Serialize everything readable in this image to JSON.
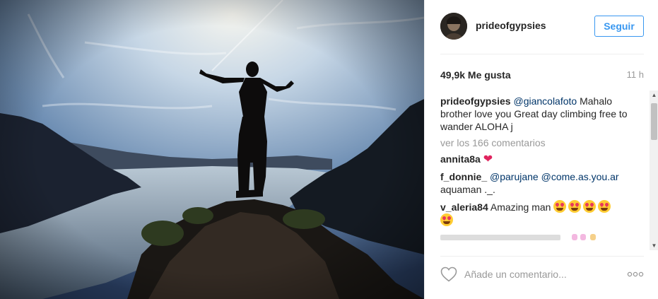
{
  "post": {
    "username": "prideofgypsies",
    "follow_label": "Seguir",
    "likes": "49,9k Me gusta",
    "time_ago": "11 h",
    "caption": {
      "user": "prideofgypsies",
      "mention": "@giancolafoto",
      "text": " Mahalo brother love you Great day climbing free to wander ALOHA j"
    },
    "view_all": "ver los 166 comentarios",
    "comments": [
      {
        "user": "annita8a",
        "text": " ",
        "emoji": "❤"
      },
      {
        "user": "f_donnie_",
        "mention1": "@parujane",
        "mention2": "@come.as.you.ar",
        "text": "aquaman ._."
      },
      {
        "user": "v_aleria84",
        "text": " Amazing man"
      }
    ],
    "comment_placeholder": "Añade un comentario...",
    "more_label": "○○○"
  },
  "colors": {
    "accent": "#3897f0",
    "mention": "#003569",
    "muted": "#999999",
    "heart": "#ed4956"
  },
  "icons": {
    "like": "heart-outline-icon",
    "more": "ellipsis-icon",
    "scroll_up": "triangle-up-icon",
    "scroll_down": "triangle-down-icon"
  }
}
